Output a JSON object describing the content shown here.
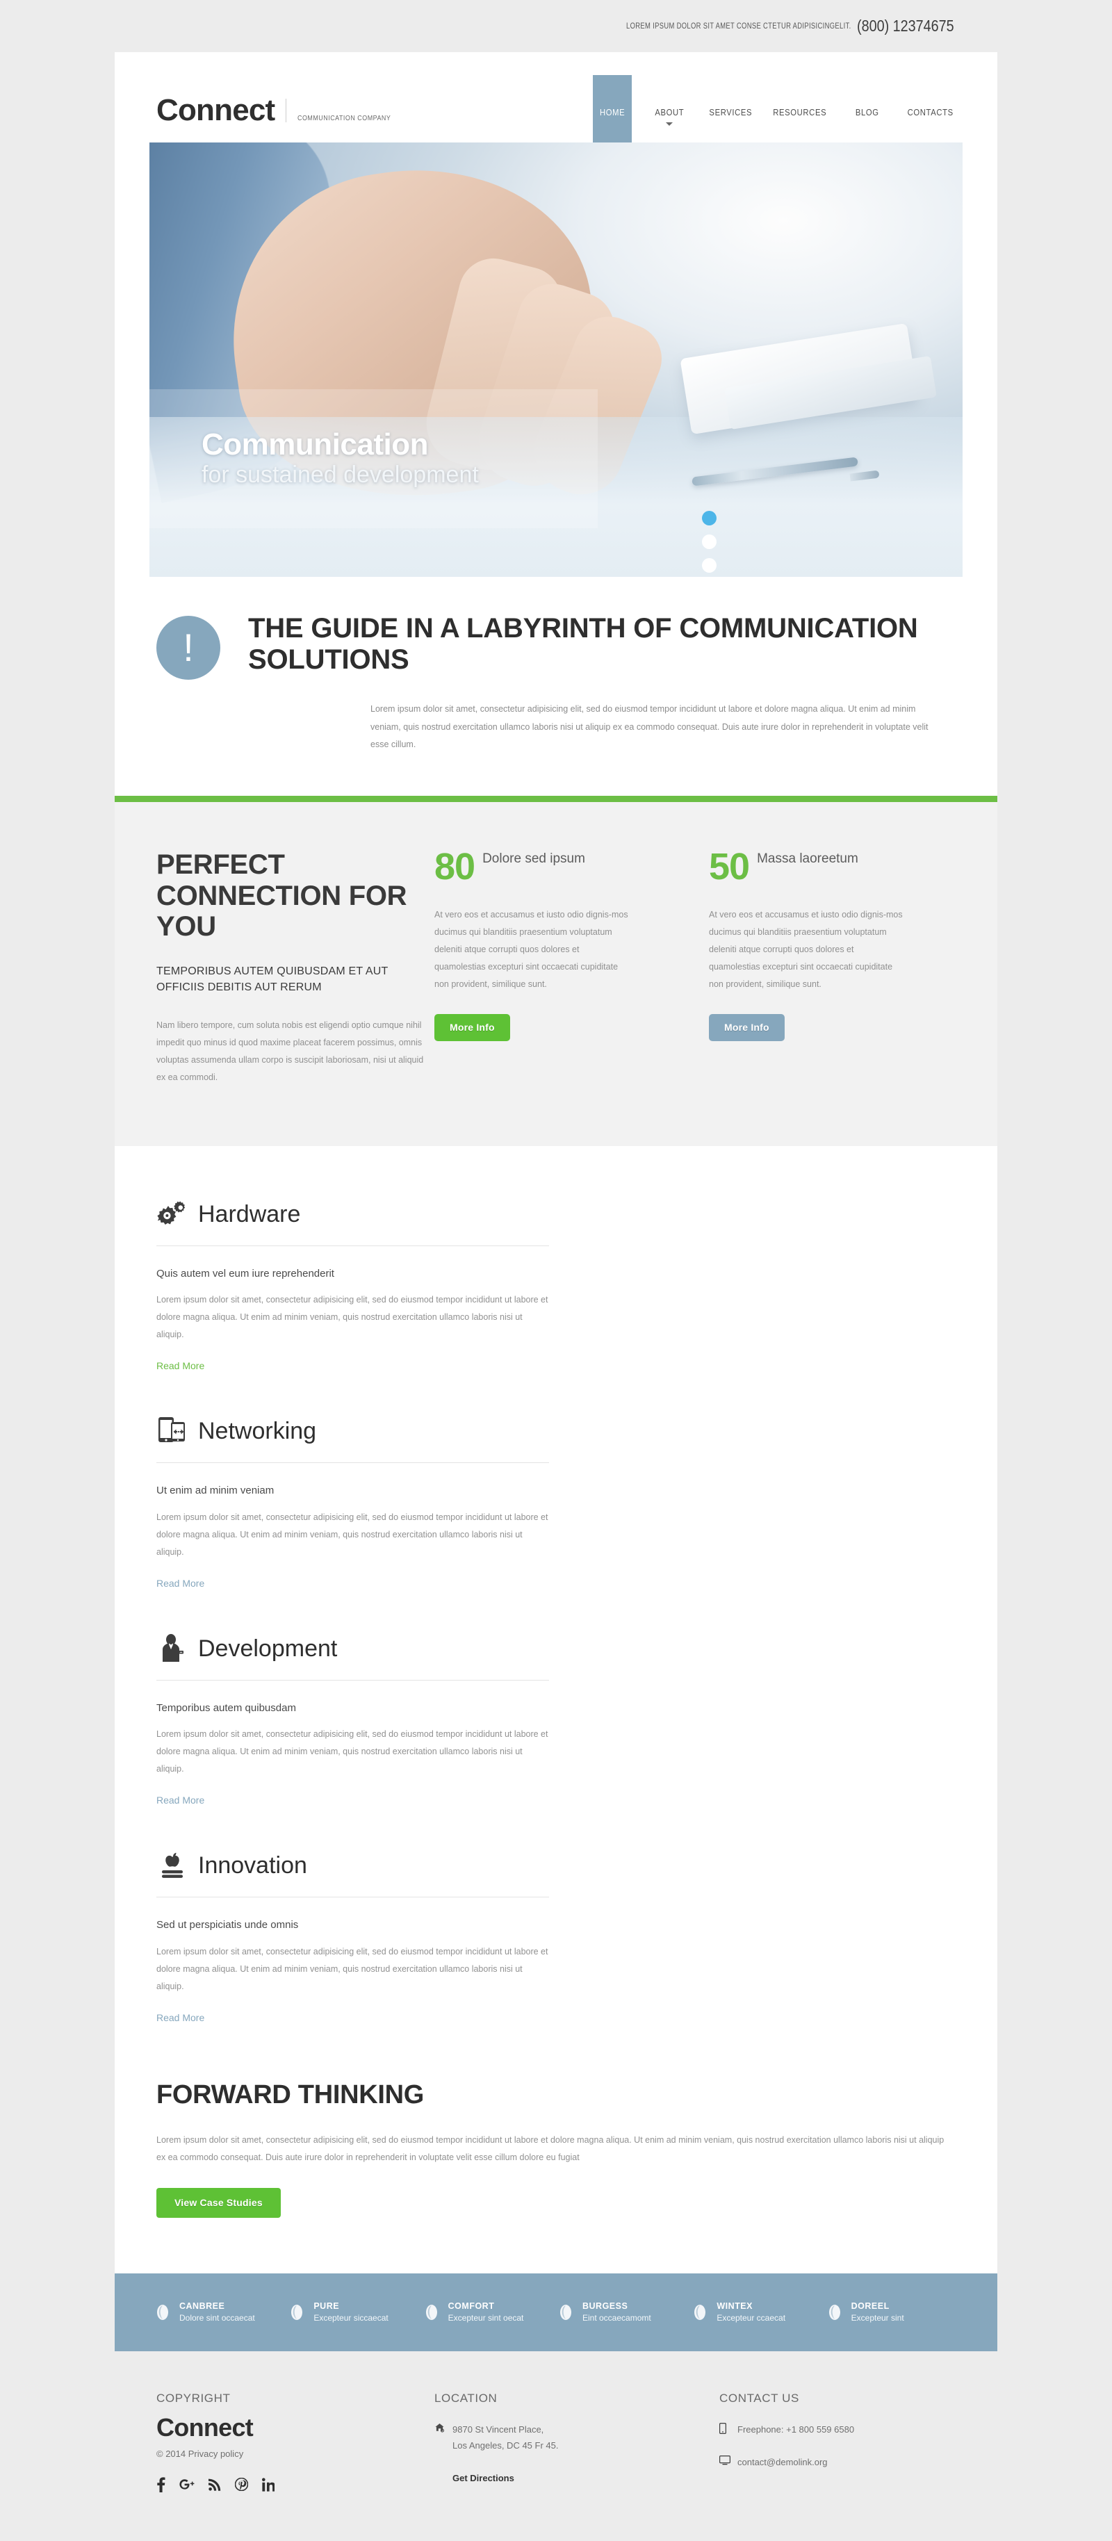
{
  "topbar": {
    "tagline": "LOREM IPSUM DOLOR SIT AMET CONSE CTETUR ADIPISICINGELIT.",
    "phone": "(800) 12374675"
  },
  "header": {
    "brand": "Connect",
    "tagline": "COMMUNICATION COMPANY",
    "nav": [
      {
        "label": "HOME",
        "active": true,
        "caret": false
      },
      {
        "label": "ABOUT",
        "active": false,
        "caret": true
      },
      {
        "label": "SERVICES",
        "active": false,
        "caret": false
      },
      {
        "label": "RESOURCES",
        "active": false,
        "caret": false
      },
      {
        "label": "BLOG",
        "active": false,
        "caret": false
      },
      {
        "label": "CONTACTS",
        "active": false,
        "caret": false
      }
    ]
  },
  "hero": {
    "title": "Communication",
    "subtitle": "for sustained development",
    "slides": 3,
    "active_slide": 1,
    "active_dot_color": "#4db5e8"
  },
  "guide": {
    "badge": "!",
    "title": "THE GUIDE IN A LABYRINTH OF COMMUNICATION SOLUTIONS",
    "text": "Lorem ipsum dolor sit amet, consectetur adipisicing elit, sed do eiusmod tempor incididunt ut labore et dolore magna aliqua. Ut enim ad minim veniam, quis nostrud exercitation ullamco laboris nisi ut aliquip ex ea commodo consequat. Duis aute irure dolor in reprehenderit in voluptate velit esse cillum."
  },
  "perfect": {
    "heading": "PERFECT CONNECTION FOR YOU",
    "subheading": "TEMPORIBUS AUTEM QUIBUSDAM ET AUT OFFICIIS DEBITIS AUT RERUM",
    "body": "Nam libero tempore, cum soluta nobis est eligendi optio cumque nihil impedit quo minus id quod maxime placeat facerem possimus, omnis voluptas assumenda ullam corpo is suscipit laboriosam, nisi ut aliquid ex ea commodi.",
    "stats": [
      {
        "number": "80",
        "label": "Dolore sed ipsum",
        "body": "At vero eos et accusamus et iusto odio dignis-mos ducimus qui blanditiis praesentium voluptatum deleniti atque corrupti quos dolores et quamolestias excepturi sint occaecati cupiditate non provident, similique sunt.",
        "button": "More Info",
        "button_style": "green"
      },
      {
        "number": "50",
        "label": "Massa laoreetum",
        "body": "At vero eos et accusamus et iusto odio dignis-mos ducimus qui blanditiis praesentium voluptatum deleniti atque corrupti quos dolores et quamolestias excepturi sint occaecati cupiditate non provident, similique sunt.",
        "button": "More Info",
        "button_style": "blue"
      }
    ]
  },
  "services": [
    {
      "icon": "gears-icon",
      "title": "Hardware",
      "subtitle": "Quis autem vel eum iure reprehenderit",
      "text": "Lorem ipsum dolor sit amet, consectetur adipisicing elit, sed do eiusmod tempor incididunt ut labore et dolore magna aliqua. Ut enim ad minim veniam, quis nostrud exercitation ullamco laboris nisi ut aliquip.",
      "link": "Read More",
      "link_style": "green"
    },
    {
      "icon": "mobile-devices-icon",
      "title": "Networking",
      "subtitle": "Ut enim ad minim veniam",
      "text": "Lorem ipsum dolor sit amet, consectetur adipisicing elit, sed do eiusmod tempor incididunt ut labore et dolore magna aliqua. Ut enim ad minim veniam, quis nostrud exercitation ullamco laboris nisi ut aliquip.",
      "link": "Read More",
      "link_style": "blue"
    },
    {
      "icon": "businessman-icon",
      "title": "Development",
      "subtitle": "Temporibus autem quibusdam",
      "text": "Lorem ipsum dolor sit amet, consectetur adipisicing elit, sed do eiusmod tempor incididunt ut labore et dolore magna aliqua. Ut enim ad minim veniam, quis nostrud exercitation ullamco laboris nisi ut aliquip.",
      "link": "Read More",
      "link_style": "blue"
    },
    {
      "icon": "apple-book-icon",
      "title": "Innovation",
      "subtitle": "Sed ut perspiciatis unde omnis",
      "text": "Lorem ipsum dolor sit amet, consectetur adipisicing elit, sed do eiusmod tempor incididunt ut labore et dolore magna aliqua. Ut enim ad minim veniam, quis nostrud exercitation ullamco laboris nisi ut aliquip.",
      "link": "Read More",
      "link_style": "blue"
    }
  ],
  "forward": {
    "title": "FORWARD THINKING",
    "text": "Lorem ipsum dolor sit amet, consectetur adipisicing elit, sed do eiusmod tempor incididunt ut labore et dolore magna aliqua. Ut enim ad minim veniam, quis nostrud exercitation ullamco laboris nisi ut aliquip ex ea commodo consequat. Duis aute irure dolor in reprehenderit in voluptate velit esse cillum dolore eu fugiat",
    "button": "View Case Studies"
  },
  "partners": [
    {
      "name": "CANBREE",
      "desc": "Dolore sint occaecat"
    },
    {
      "name": "PURE",
      "desc": "Excepteur siccaecat"
    },
    {
      "name": "COMFORT",
      "desc": "Excepteur sint oecat"
    },
    {
      "name": "BURGESS",
      "desc": "Eint occaecamomt"
    },
    {
      "name": "WINTEX",
      "desc": "Excepteur ccaecat"
    },
    {
      "name": "DOREEL",
      "desc": "Excepteur sint"
    }
  ],
  "footer": {
    "copyright_head": "COPYRIGHT",
    "brand": "Connect",
    "copyright_line": "© 2014 Privacy policy",
    "socials": [
      "facebook-icon",
      "google-plus-icon",
      "rss-icon",
      "pinterest-icon",
      "linkedin-icon"
    ],
    "location_head": "LOCATION",
    "address_line1": "9870 St Vincent Place,",
    "address_line2": "Los Angeles, DC 45 Fr 45.",
    "directions_link": "Get Directions",
    "contact_head": "CONTACT US",
    "phone_label": "Freephone:  +1 800 559 6580",
    "email": "contact@demolink.org"
  },
  "colors": {
    "green": "#6cbe45",
    "blue": "#86a7bd",
    "page_bg": "#ececec",
    "grey_section": "#f2f2f2"
  }
}
